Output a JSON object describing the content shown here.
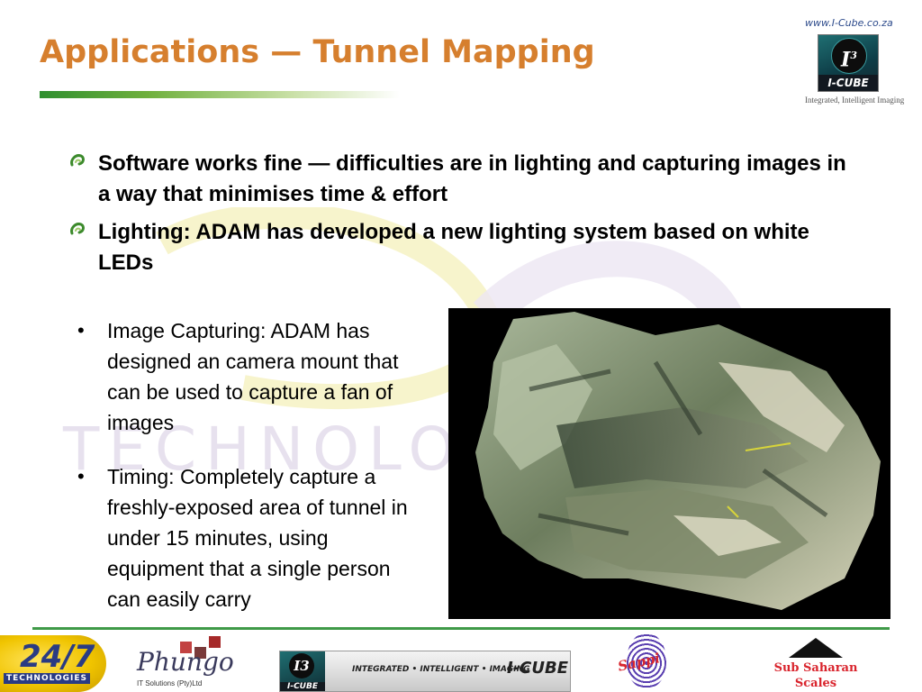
{
  "header": {
    "title": "Applications — Tunnel Mapping",
    "site_url": "www.I-Cube.co.za",
    "logo": {
      "mark": "I",
      "mark_sup": "3",
      "wordmark": "I-CUBE",
      "tagline": "Integrated, Intelligent Imaging"
    }
  },
  "watermark": {
    "text": "TECHNOLOG"
  },
  "main_bullets": [
    {
      "text": "Software works fine — difficulties are in lighting and capturing images in a way that minimises time & effort"
    },
    {
      "text": "Lighting: ADAM has developed a new lighting system based on white LEDs"
    }
  ],
  "sub_bullets": [
    {
      "text": "Image Capturing: ADAM has designed an camera mount that can be used to capture a fan of images"
    },
    {
      "text": "Timing: Completely capture a freshly-exposed area of tunnel in under 15 minutes, using equipment that a single person can easily carry"
    }
  ],
  "sub_bullet_marker": "•",
  "photo": {
    "icon": "3d-rock-scan-image"
  },
  "footer": {
    "logo_247": {
      "number": "24/7",
      "label": "TECHNOLOGIES"
    },
    "logo_phungo": {
      "script": "Phungo",
      "sub": "IT Solutions (Pty)Ltd"
    },
    "logo_icube": {
      "mark": "I3",
      "wordmark": "I-CUBE",
      "tagline": "INTEGRATED • INTELLIGENT • IMAGING",
      "brand": "I-CUBE"
    },
    "logo_fingerprint": {
      "script": "Sappi"
    },
    "logo_sss": {
      "line1": "Sub Saharan",
      "line2": "Scales"
    }
  },
  "colors": {
    "title": "#d67f2e",
    "rule_green": "#2f8f2f",
    "bottom_rule": "#3f9a48",
    "bullet_icon_green": "#3c8a2c"
  }
}
